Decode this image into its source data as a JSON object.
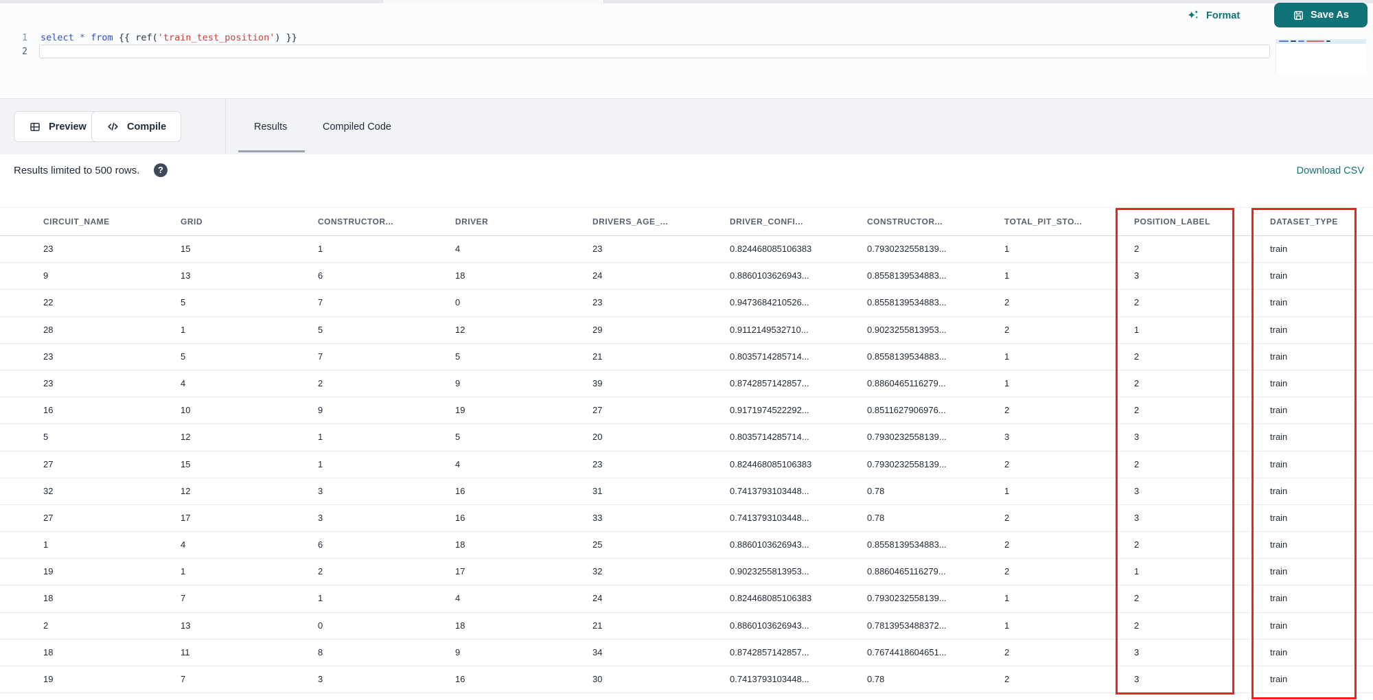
{
  "top_bar": {
    "format_label": "Format",
    "save_as_label": "Save As"
  },
  "editor": {
    "line1": {
      "num": "1",
      "kw_select": "select",
      "star": " * ",
      "kw_from": "from",
      "brace_open": " {{ ",
      "ref_call": "ref(",
      "string": "'train_test_position'",
      "tail": ") }}"
    },
    "line2": {
      "num": "2"
    }
  },
  "panel": {
    "preview_label": "Preview",
    "compile_label": "Compile",
    "tabs": [
      {
        "label": "Results",
        "active": true
      },
      {
        "label": "Compiled Code",
        "active": false
      }
    ]
  },
  "results_bar": {
    "notice": "Results limited to 500 rows.",
    "help_glyph": "?",
    "download_label": "Download CSV"
  },
  "table": {
    "columns": [
      "CIRCUIT_NAME",
      "GRID",
      "CONSTRUCTOR...",
      "DRIVER",
      "DRIVERS_AGE_...",
      "DRIVER_CONFI...",
      "CONSTRUCTOR...",
      "TOTAL_PIT_STO...",
      "POSITION_LABEL",
      "DATASET_TYPE"
    ],
    "highlighted_columns": [
      "POSITION_LABEL",
      "DATASET_TYPE"
    ],
    "rows": [
      [
        "23",
        "15",
        "1",
        "4",
        "23",
        "0.824468085106383",
        "0.7930232558139...",
        "1",
        "2",
        "train"
      ],
      [
        "9",
        "13",
        "6",
        "18",
        "24",
        "0.8860103626943...",
        "0.8558139534883...",
        "1",
        "3",
        "train"
      ],
      [
        "22",
        "5",
        "7",
        "0",
        "23",
        "0.9473684210526...",
        "0.8558139534883...",
        "2",
        "2",
        "train"
      ],
      [
        "28",
        "1",
        "5",
        "12",
        "29",
        "0.9112149532710...",
        "0.9023255813953...",
        "2",
        "1",
        "train"
      ],
      [
        "23",
        "5",
        "7",
        "5",
        "21",
        "0.8035714285714...",
        "0.8558139534883...",
        "1",
        "2",
        "train"
      ],
      [
        "23",
        "4",
        "2",
        "9",
        "39",
        "0.8742857142857...",
        "0.8860465116279...",
        "1",
        "2",
        "train"
      ],
      [
        "16",
        "10",
        "9",
        "19",
        "27",
        "0.9171974522292...",
        "0.8511627906976...",
        "2",
        "2",
        "train"
      ],
      [
        "5",
        "12",
        "1",
        "5",
        "20",
        "0.8035714285714...",
        "0.7930232558139...",
        "3",
        "3",
        "train"
      ],
      [
        "27",
        "15",
        "1",
        "4",
        "23",
        "0.824468085106383",
        "0.7930232558139...",
        "2",
        "2",
        "train"
      ],
      [
        "32",
        "12",
        "3",
        "16",
        "31",
        "0.7413793103448...",
        "0.78",
        "1",
        "3",
        "train"
      ],
      [
        "27",
        "17",
        "3",
        "16",
        "33",
        "0.7413793103448...",
        "0.78",
        "2",
        "3",
        "train"
      ],
      [
        "1",
        "4",
        "6",
        "18",
        "25",
        "0.8860103626943...",
        "0.8558139534883...",
        "2",
        "2",
        "train"
      ],
      [
        "19",
        "1",
        "2",
        "17",
        "32",
        "0.9023255813953...",
        "0.8860465116279...",
        "2",
        "1",
        "train"
      ],
      [
        "18",
        "7",
        "1",
        "4",
        "24",
        "0.824468085106383",
        "0.7930232558139...",
        "1",
        "2",
        "train"
      ],
      [
        "2",
        "13",
        "0",
        "18",
        "21",
        "0.8860103626943...",
        "0.7813953488372...",
        "1",
        "2",
        "train"
      ],
      [
        "18",
        "11",
        "8",
        "9",
        "34",
        "0.8742857142857...",
        "0.7674418604651...",
        "2",
        "3",
        "train"
      ],
      [
        "19",
        "7",
        "3",
        "16",
        "30",
        "0.7413793103448...",
        "0.78",
        "2",
        "3",
        "train"
      ]
    ]
  },
  "colors": {
    "accent": "#0f7377",
    "annotation": "#ed221f"
  }
}
